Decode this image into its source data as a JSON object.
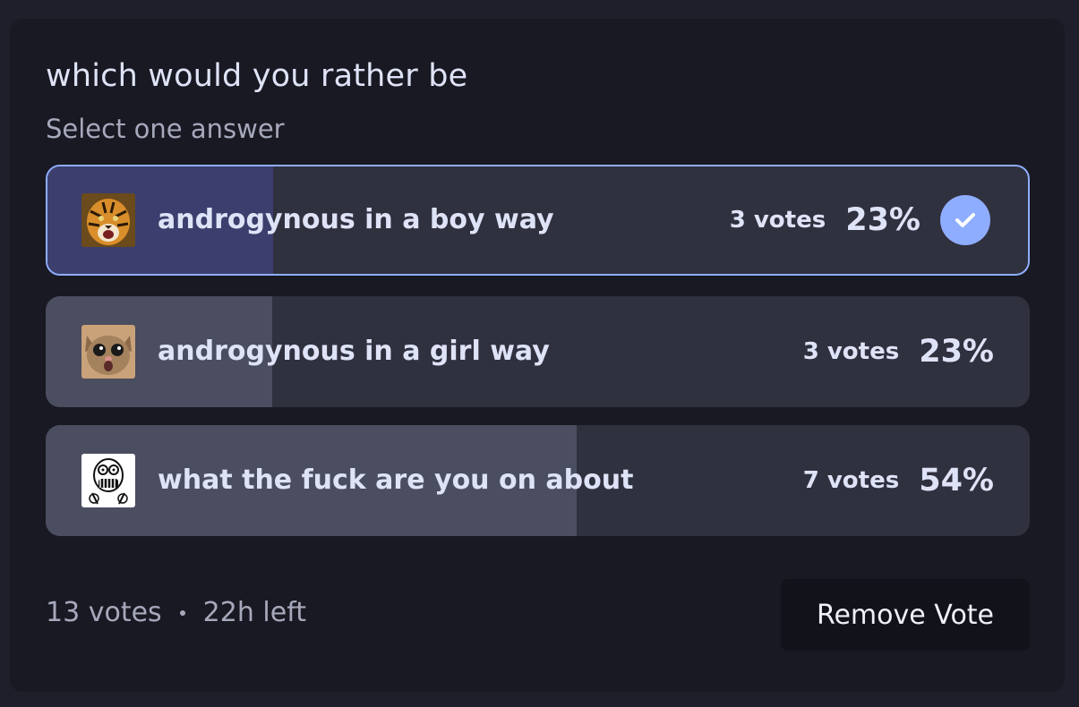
{
  "poll": {
    "question": "which would you rather be",
    "instruction": "Select one answer",
    "answers": [
      {
        "label": "androgynous in a boy way",
        "votes": "3 votes",
        "percent": "23%",
        "fraction": 0.23,
        "selected": true,
        "thumbnail": "tiger-image"
      },
      {
        "label": "androgynous in a girl way",
        "votes": "3 votes",
        "percent": "23%",
        "fraction": 0.23,
        "selected": false,
        "thumbnail": "cat-image"
      },
      {
        "label": "what the fuck are you on about",
        "votes": "7 votes",
        "percent": "54%",
        "fraction": 0.54,
        "selected": false,
        "thumbnail": "rage-face-image"
      }
    ],
    "total_votes": "13 votes",
    "time_left": "22h left",
    "remove_vote_label": "Remove Vote"
  },
  "colors": {
    "accent": "#8fadff",
    "selected_fill": "#3c3f6d",
    "fill": "#4b4d60",
    "track": "#30313f",
    "card_bg": "#181922"
  }
}
